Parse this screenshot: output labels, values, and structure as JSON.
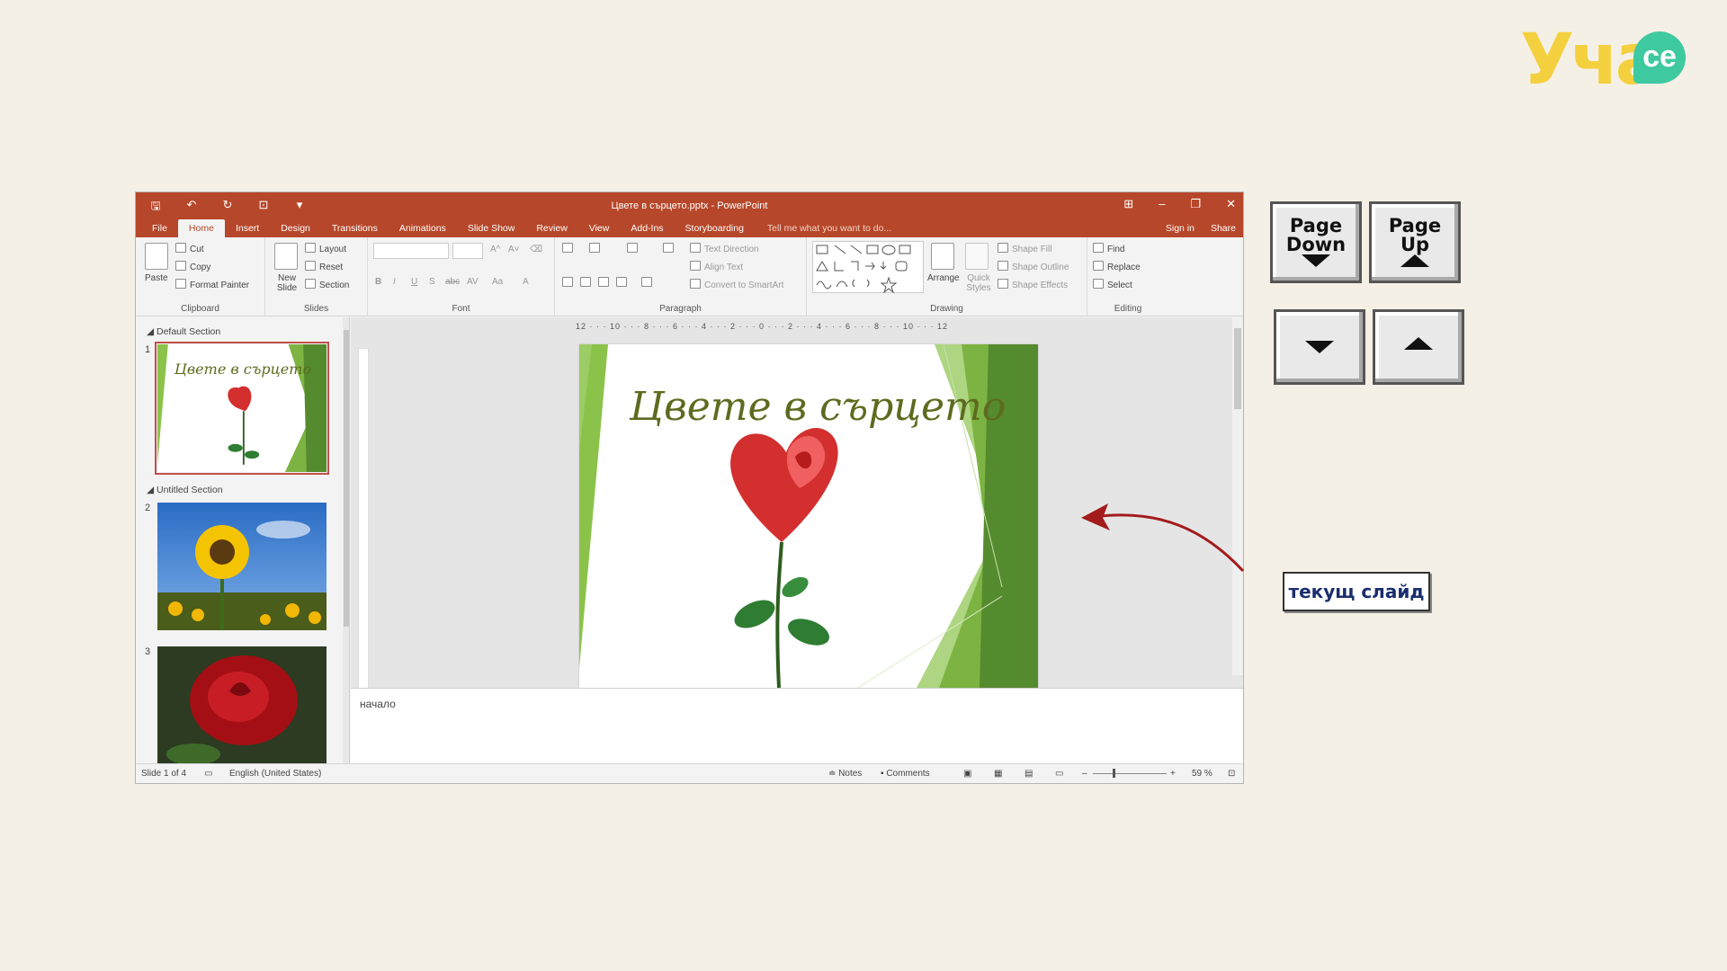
{
  "logo": {
    "text": "Уча",
    "bubble": "се"
  },
  "window": {
    "title": "Цвете в сърцето.pptx - PowerPoint",
    "qat": {
      "save": "🖫",
      "undo": "↶",
      "redo": "↻",
      "start": "⊡",
      "more": "▾"
    },
    "controls": {
      "ribbon_opts": "⊞",
      "minimize": "–",
      "restore": "❐",
      "close": "✕"
    }
  },
  "tabs": [
    "File",
    "Home",
    "Insert",
    "Design",
    "Transitions",
    "Animations",
    "Slide Show",
    "Review",
    "View",
    "Add-Ins",
    "Storyboarding"
  ],
  "active_tab": "Home",
  "tell_me": "Tell me what you want to do...",
  "sign_in": "Sign in",
  "share": "Share",
  "ribbon": {
    "clipboard": {
      "paste": "Paste",
      "cut": "Cut",
      "copy": "Copy",
      "format_painter": "Format Painter",
      "label": "Clipboard"
    },
    "slides": {
      "new_slide": "New Slide",
      "layout": "Layout",
      "reset": "Reset",
      "section": "Section",
      "label": "Slides"
    },
    "font": {
      "bold": "B",
      "italic": "I",
      "underline": "U",
      "shadow": "S",
      "strike": "abc",
      "spacing": "AV",
      "case": "Aa",
      "color": "A",
      "grow": "A^",
      "shrink": "A˅",
      "clear": "⌫",
      "label": "Font"
    },
    "paragraph": {
      "text_direction": "Text Direction",
      "align_text": "Align Text",
      "smartart": "Convert to SmartArt",
      "label": "Paragraph"
    },
    "drawing": {
      "arrange": "Arrange",
      "quick_styles": "Quick Styles",
      "shape_fill": "Shape Fill",
      "shape_outline": "Shape Outline",
      "shape_effects": "Shape Effects",
      "label": "Drawing"
    },
    "editing": {
      "find": "Find",
      "replace": "Replace",
      "select": "Select",
      "label": "Editing"
    }
  },
  "sections": {
    "default": "Default Section",
    "untitled": "Untitled Section"
  },
  "slide_numbers": [
    "1",
    "2",
    "3"
  ],
  "ruler": "12 · · · 10 · · · 8 · · · 6 · · · 4 · · · 2 · · · 0 · · · 2 · · · 4 · · · 6 · · · 8 · · · 10 · · · 12",
  "slide": {
    "title": "Цвете в сърцето"
  },
  "thumb1_title": "Цвете в сърцето",
  "notes": "начало",
  "status": {
    "slide_of": "Slide 1 of 4",
    "language": "English (United States)",
    "notes": "Notes",
    "comments": "Comments",
    "zoom": "59 %"
  },
  "keys": {
    "page_down": [
      "Page",
      "Down"
    ],
    "page_up": [
      "Page",
      "Up"
    ]
  },
  "current_slide_label": "текущ слайд",
  "colors": {
    "accent": "#b7472a",
    "arrow": "#a31b1b",
    "slide_green": "#7cb342"
  }
}
